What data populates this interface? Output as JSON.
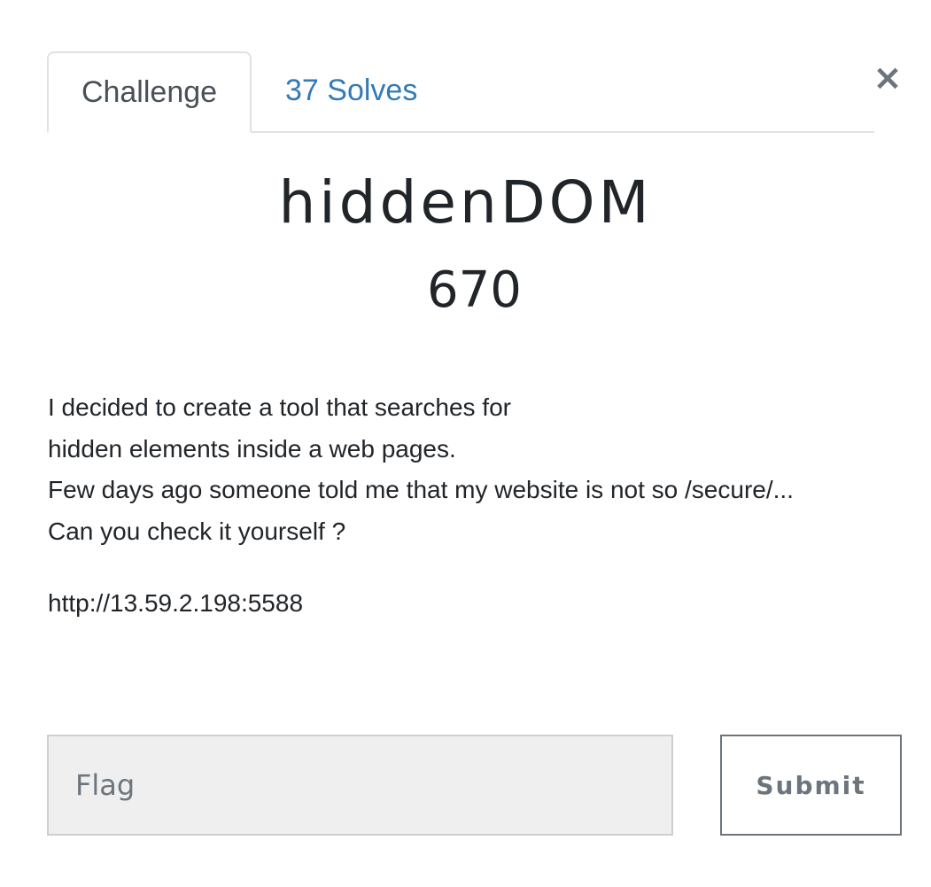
{
  "modal": {
    "close_label": "×"
  },
  "tabs": [
    {
      "label": "Challenge",
      "active": true
    },
    {
      "label": "37 Solves",
      "active": false
    }
  ],
  "challenge": {
    "name": "hiddenDOM",
    "value": "670",
    "description_lines": [
      "I decided to create a tool that searches for",
      "hidden elements inside a web pages.",
      "Few days ago someone told me that my website is not so /secure/...",
      "Can you check it yourself ?"
    ],
    "url": "http://13.59.2.198:5588"
  },
  "submission": {
    "flag_placeholder": "Flag",
    "flag_value": "",
    "submit_label": "Submit"
  },
  "colors": {
    "link": "#337ab7",
    "text": "#212529",
    "muted": "#6c757d",
    "input_bg": "#efefef",
    "border": "#dee2e6"
  }
}
